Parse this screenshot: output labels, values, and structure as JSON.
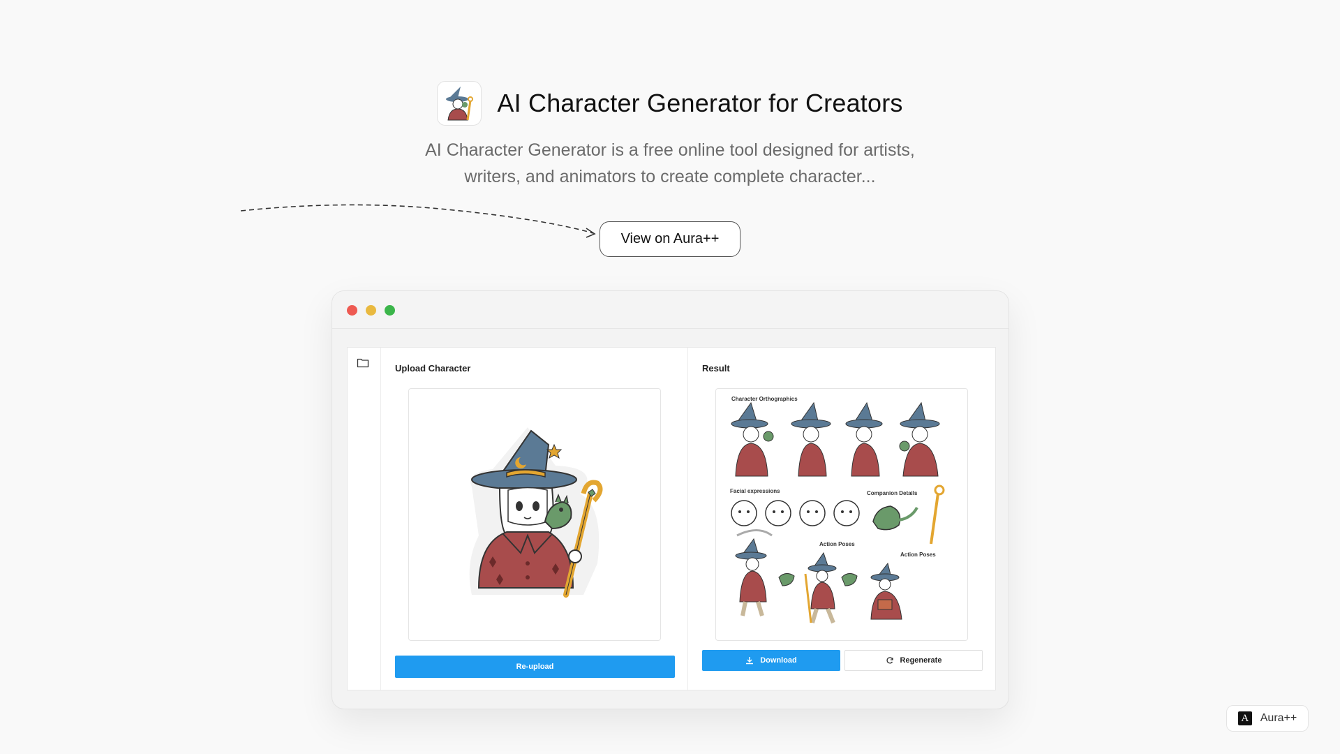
{
  "hero": {
    "title": "AI Character Generator for Creators",
    "subtitle_line1": "AI Character Generator is a free online tool designed for artists,",
    "subtitle_line2": "writers, and animators to create complete character...",
    "cta_label": "View on Aura++"
  },
  "window": {
    "upload_panel": {
      "title": "Upload Character",
      "button_label": "Re-upload"
    },
    "result_panel": {
      "title": "Result",
      "sheet_labels": {
        "orthographics": "Character Orthographics",
        "facial": "Facial expressions",
        "companion": "Companion Details",
        "action1": "Action Poses",
        "action2": "Action Poses"
      },
      "download_label": "Download",
      "regenerate_label": "Regenerate"
    }
  },
  "badge": {
    "logo_letter": "A",
    "label": "Aura++"
  },
  "colors": {
    "accent": "#1f9bf0",
    "hat": "#5b7a95",
    "cloak": "#a84c4c",
    "dragon": "#6a9a6a",
    "staff": "#e3a631"
  }
}
